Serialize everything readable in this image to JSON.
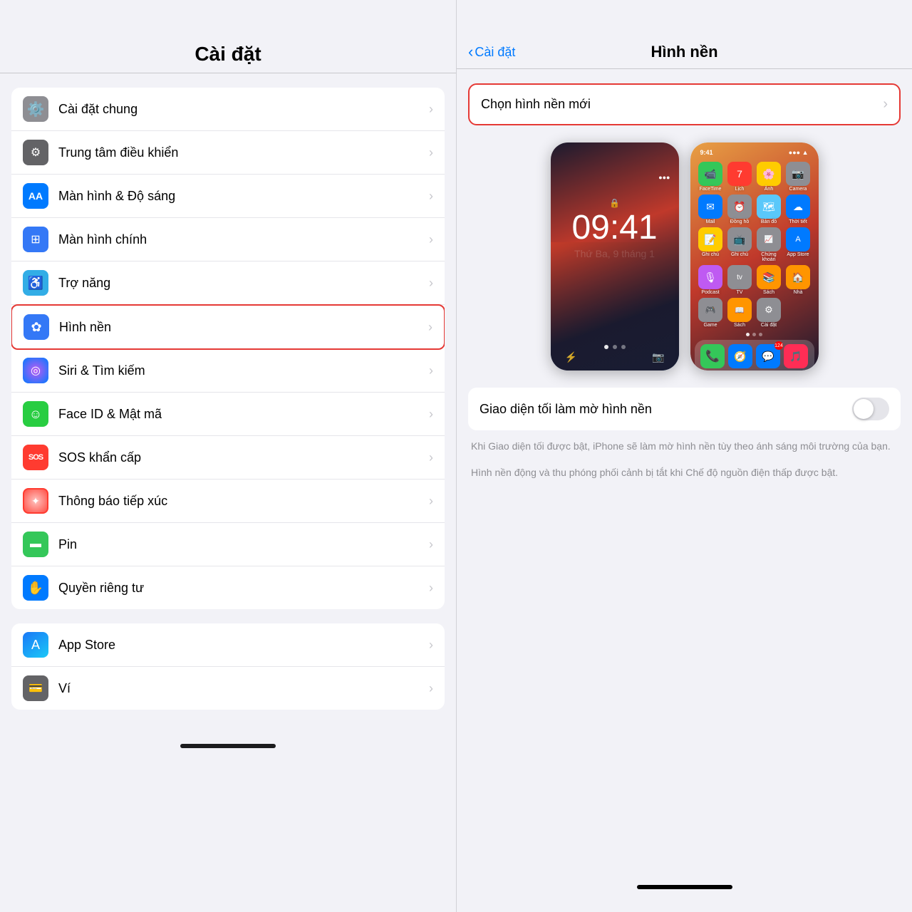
{
  "left": {
    "title": "Cài đặt",
    "groups": [
      {
        "items": [
          {
            "id": "cai-dat-chung",
            "label": "Cài đặt chung",
            "icon": "⚙️",
            "iconBg": "icon-gray",
            "highlighted": false
          },
          {
            "id": "trung-tam-dieu-khien",
            "label": "Trung tâm điều khiển",
            "icon": "⚙",
            "iconBg": "icon-gray2",
            "highlighted": false
          },
          {
            "id": "man-hinh-do-sang",
            "label": "Màn hình & Độ sáng",
            "icon": "AA",
            "iconBg": "icon-blue",
            "highlighted": false
          },
          {
            "id": "man-hinh-chinh",
            "label": "Màn hình chính",
            "icon": "⊞",
            "iconBg": "icon-blue2",
            "highlighted": false
          },
          {
            "id": "tro-nang",
            "label": "Trợ năng",
            "icon": "♿",
            "iconBg": "icon-blue3",
            "highlighted": false
          },
          {
            "id": "hinh-nen",
            "label": "Hình nền",
            "icon": "✿",
            "iconBg": "icon-blue2",
            "highlighted": true
          },
          {
            "id": "siri-tim-kiem",
            "label": "Siri & Tìm kiếm",
            "icon": "◎",
            "iconBg": "icon-indigo",
            "highlighted": false
          },
          {
            "id": "face-id-mat-ma",
            "label": "Face ID & Mật mã",
            "icon": "☺",
            "iconBg": "icon-green2",
            "highlighted": false
          },
          {
            "id": "sos-khan-cap",
            "label": "SOS khẩn cấp",
            "icon": "SOS",
            "iconBg": "icon-red",
            "highlighted": false
          },
          {
            "id": "thong-bao-tiep-xuc",
            "label": "Thông báo tiếp xúc",
            "icon": "✦",
            "iconBg": "icon-red",
            "highlighted": false
          },
          {
            "id": "pin",
            "label": "Pin",
            "icon": "▬",
            "iconBg": "icon-green",
            "highlighted": false
          },
          {
            "id": "quyen-rieng-tu",
            "label": "Quyền riêng tư",
            "icon": "✋",
            "iconBg": "icon-blue",
            "highlighted": false
          }
        ]
      },
      {
        "items": [
          {
            "id": "app-store",
            "label": "App Store",
            "icon": "A",
            "iconBg": "icon-blue2",
            "highlighted": false
          },
          {
            "id": "vi",
            "label": "Ví",
            "icon": "💳",
            "iconBg": "icon-gray2",
            "highlighted": false
          }
        ]
      }
    ]
  },
  "right": {
    "title": "Hình nền",
    "back_label": "Cài đặt",
    "choose_label": "Chọn hình nền mới",
    "toggle_label": "Giao diện tối làm mờ hình nền",
    "toggle_state": false,
    "info_text_1": "Khi Giao diện tối được bật, iPhone sẽ làm mờ hình nền tùy theo ánh sáng môi trường của bạn.",
    "info_text_2": "Hình nền động và thu phóng phối cảnh bị tắt khi Chế độ nguồn điện thấp được bật.",
    "lock_time": "09:41",
    "lock_date": "Thứ Ba, 9 tháng 1",
    "home_time": "9:41"
  }
}
